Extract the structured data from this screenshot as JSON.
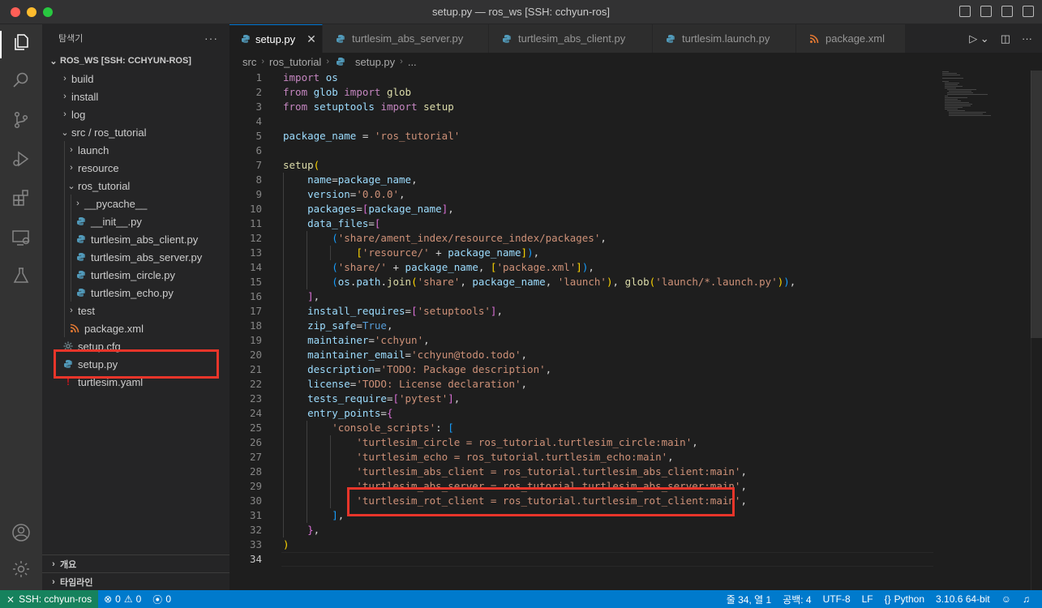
{
  "window": {
    "title": "setup.py — ros_ws [SSH: cchyun-ros]"
  },
  "sidebar": {
    "header": "탐색기",
    "more": "···",
    "root": "ROS_WS [SSH: CCHYUN-ROS]",
    "items": [
      {
        "label": "build",
        "type": "folder",
        "chev": "›"
      },
      {
        "label": "install",
        "type": "folder",
        "chev": "›"
      },
      {
        "label": "log",
        "type": "folder",
        "chev": "›"
      },
      {
        "label": "src / ros_tutorial",
        "type": "folder",
        "chev": "⌄"
      },
      {
        "label": "launch",
        "type": "folder",
        "chev": "›"
      },
      {
        "label": "resource",
        "type": "folder",
        "chev": "›"
      },
      {
        "label": "ros_tutorial",
        "type": "folder",
        "chev": "⌄"
      },
      {
        "label": "__pycache__",
        "type": "folder",
        "chev": "›"
      },
      {
        "label": "__init__.py",
        "type": "python"
      },
      {
        "label": "turtlesim_abs_client.py",
        "type": "python"
      },
      {
        "label": "turtlesim_abs_server.py",
        "type": "python"
      },
      {
        "label": "turtlesim_circle.py",
        "type": "python"
      },
      {
        "label": "turtlesim_echo.py",
        "type": "python"
      },
      {
        "label": "test",
        "type": "folder",
        "chev": "›"
      },
      {
        "label": "package.xml",
        "type": "xml"
      },
      {
        "label": "setup.cfg",
        "type": "gear"
      },
      {
        "label": "setup.py",
        "type": "python"
      },
      {
        "label": "turtlesim.yaml",
        "type": "yaml"
      }
    ],
    "outline": "개요",
    "timeline": "타임라인"
  },
  "tabs": [
    {
      "label": "setup.py",
      "active": true,
      "icon": "python-icon"
    },
    {
      "label": "turtlesim_abs_server.py",
      "active": false,
      "icon": "python-icon"
    },
    {
      "label": "turtlesim_abs_client.py",
      "active": false,
      "icon": "python-icon"
    },
    {
      "label": "turtlesim.launch.py",
      "active": false,
      "icon": "python-icon"
    },
    {
      "label": "package.xml",
      "active": false,
      "icon": "rss-icon"
    }
  ],
  "tab_close": "✕",
  "breadcrumb": {
    "part1": "src",
    "part2": "ros_tutorial",
    "file": "setup.py",
    "tail": "..."
  },
  "editor": {
    "current_line": 34,
    "lines": [
      [
        [
          "kw",
          "import"
        ],
        [
          "pl",
          " "
        ],
        [
          "vr",
          "os"
        ]
      ],
      [
        [
          "kw",
          "from"
        ],
        [
          "pl",
          " "
        ],
        [
          "vr",
          "glob"
        ],
        [
          "pl",
          " "
        ],
        [
          "kw",
          "import"
        ],
        [
          "pl",
          " "
        ],
        [
          "fn",
          "glob"
        ]
      ],
      [
        [
          "kw",
          "from"
        ],
        [
          "pl",
          " "
        ],
        [
          "vr",
          "setuptools"
        ],
        [
          "pl",
          " "
        ],
        [
          "kw",
          "import"
        ],
        [
          "pl",
          " "
        ],
        [
          "fn",
          "setup"
        ]
      ],
      [],
      [
        [
          "vr",
          "package_name"
        ],
        [
          "pl",
          " = "
        ],
        [
          "st",
          "'ros_tutorial'"
        ]
      ],
      [],
      [
        [
          "fn",
          "setup"
        ],
        [
          "b1",
          "("
        ]
      ],
      [
        [
          "pl",
          "    "
        ],
        [
          "vr",
          "name"
        ],
        [
          "pl",
          "="
        ],
        [
          "vr",
          "package_name"
        ],
        [
          "pl",
          ","
        ]
      ],
      [
        [
          "pl",
          "    "
        ],
        [
          "vr",
          "version"
        ],
        [
          "pl",
          "="
        ],
        [
          "st",
          "'0.0.0'"
        ],
        [
          "pl",
          ","
        ]
      ],
      [
        [
          "pl",
          "    "
        ],
        [
          "vr",
          "packages"
        ],
        [
          "pl",
          "="
        ],
        [
          "b2",
          "["
        ],
        [
          "vr",
          "package_name"
        ],
        [
          "b2",
          "]"
        ],
        [
          "pl",
          ","
        ]
      ],
      [
        [
          "pl",
          "    "
        ],
        [
          "vr",
          "data_files"
        ],
        [
          "pl",
          "="
        ],
        [
          "b2",
          "["
        ]
      ],
      [
        [
          "pl",
          "        "
        ],
        [
          "b3",
          "("
        ],
        [
          "st",
          "'share/ament_index/resource_index/packages'"
        ],
        [
          "pl",
          ","
        ]
      ],
      [
        [
          "pl",
          "            "
        ],
        [
          "b1",
          "["
        ],
        [
          "st",
          "'resource/'"
        ],
        [
          "pl",
          " + "
        ],
        [
          "vr",
          "package_name"
        ],
        [
          "b1",
          "]"
        ],
        [
          "b3",
          ")"
        ],
        [
          "pl",
          ","
        ]
      ],
      [
        [
          "pl",
          "        "
        ],
        [
          "b3",
          "("
        ],
        [
          "st",
          "'share/'"
        ],
        [
          "pl",
          " + "
        ],
        [
          "vr",
          "package_name"
        ],
        [
          "pl",
          ", "
        ],
        [
          "b1",
          "["
        ],
        [
          "st",
          "'package.xml'"
        ],
        [
          "b1",
          "]"
        ],
        [
          "b3",
          ")"
        ],
        [
          "pl",
          ","
        ]
      ],
      [
        [
          "pl",
          "        "
        ],
        [
          "b3",
          "("
        ],
        [
          "vr",
          "os"
        ],
        [
          "pl",
          "."
        ],
        [
          "vr",
          "path"
        ],
        [
          "pl",
          "."
        ],
        [
          "fn",
          "join"
        ],
        [
          "b1",
          "("
        ],
        [
          "st",
          "'share'"
        ],
        [
          "pl",
          ", "
        ],
        [
          "vr",
          "package_name"
        ],
        [
          "pl",
          ", "
        ],
        [
          "st",
          "'launch'"
        ],
        [
          "b1",
          ")"
        ],
        [
          "pl",
          ", "
        ],
        [
          "fn",
          "glob"
        ],
        [
          "b1",
          "("
        ],
        [
          "st",
          "'launch/*.launch.py'"
        ],
        [
          "b1",
          ")"
        ],
        [
          "b3",
          ")"
        ],
        [
          "pl",
          ","
        ]
      ],
      [
        [
          "pl",
          "    "
        ],
        [
          "b2",
          "]"
        ],
        [
          "pl",
          ","
        ]
      ],
      [
        [
          "pl",
          "    "
        ],
        [
          "vr",
          "install_requires"
        ],
        [
          "pl",
          "="
        ],
        [
          "b2",
          "["
        ],
        [
          "st",
          "'setuptools'"
        ],
        [
          "b2",
          "]"
        ],
        [
          "pl",
          ","
        ]
      ],
      [
        [
          "pl",
          "    "
        ],
        [
          "vr",
          "zip_safe"
        ],
        [
          "pl",
          "="
        ],
        [
          "bl",
          "True"
        ],
        [
          "pl",
          ","
        ]
      ],
      [
        [
          "pl",
          "    "
        ],
        [
          "vr",
          "maintainer"
        ],
        [
          "pl",
          "="
        ],
        [
          "st",
          "'cchyun'"
        ],
        [
          "pl",
          ","
        ]
      ],
      [
        [
          "pl",
          "    "
        ],
        [
          "vr",
          "maintainer_email"
        ],
        [
          "pl",
          "="
        ],
        [
          "st",
          "'cchyun@todo.todo'"
        ],
        [
          "pl",
          ","
        ]
      ],
      [
        [
          "pl",
          "    "
        ],
        [
          "vr",
          "description"
        ],
        [
          "pl",
          "="
        ],
        [
          "st",
          "'TODO: Package description'"
        ],
        [
          "pl",
          ","
        ]
      ],
      [
        [
          "pl",
          "    "
        ],
        [
          "vr",
          "license"
        ],
        [
          "pl",
          "="
        ],
        [
          "st",
          "'TODO: License declaration'"
        ],
        [
          "pl",
          ","
        ]
      ],
      [
        [
          "pl",
          "    "
        ],
        [
          "vr",
          "tests_require"
        ],
        [
          "pl",
          "="
        ],
        [
          "b2",
          "["
        ],
        [
          "st",
          "'pytest'"
        ],
        [
          "b2",
          "]"
        ],
        [
          "pl",
          ","
        ]
      ],
      [
        [
          "pl",
          "    "
        ],
        [
          "vr",
          "entry_points"
        ],
        [
          "pl",
          "="
        ],
        [
          "b2",
          "{"
        ]
      ],
      [
        [
          "pl",
          "        "
        ],
        [
          "st",
          "'console_scripts'"
        ],
        [
          "pl",
          ": "
        ],
        [
          "b3",
          "["
        ]
      ],
      [
        [
          "pl",
          "            "
        ],
        [
          "st",
          "'turtlesim_circle = ros_tutorial.turtlesim_circle:main'"
        ],
        [
          "pl",
          ","
        ]
      ],
      [
        [
          "pl",
          "            "
        ],
        [
          "st",
          "'turtlesim_echo = ros_tutorial.turtlesim_echo:main'"
        ],
        [
          "pl",
          ","
        ]
      ],
      [
        [
          "pl",
          "            "
        ],
        [
          "st",
          "'turtlesim_abs_client = ros_tutorial.turtlesim_abs_client:main'"
        ],
        [
          "pl",
          ","
        ]
      ],
      [
        [
          "pl",
          "            "
        ],
        [
          "st",
          "'turtlesim_abs_server = ros_tutorial.turtlesim_abs_server:main'"
        ],
        [
          "pl",
          ","
        ]
      ],
      [
        [
          "pl",
          "            "
        ],
        [
          "st",
          "'turtlesim_rot_client = ros_tutorial.turtlesim_rot_client:main'"
        ],
        [
          "pl",
          ","
        ]
      ],
      [
        [
          "pl",
          "        "
        ],
        [
          "b3",
          "]"
        ],
        [
          "pl",
          ","
        ]
      ],
      [
        [
          "pl",
          "    "
        ],
        [
          "b2",
          "}"
        ],
        [
          "pl",
          ","
        ]
      ],
      [
        [
          "b1",
          ")"
        ]
      ],
      []
    ]
  },
  "status": {
    "remote": "SSH: cchyun-ros",
    "errors": "0",
    "warnings": "0",
    "ports": "0",
    "cursor": "줄 34, 열 1",
    "indent": "공백: 4",
    "encoding": "UTF-8",
    "eol": "LF",
    "language": "Python",
    "interpreter": "3.10.6 64-bit"
  },
  "colors": {
    "statusbar": "#007acc",
    "remote": "#16825d",
    "highlight": "#e8352a",
    "python": "#519aba"
  }
}
